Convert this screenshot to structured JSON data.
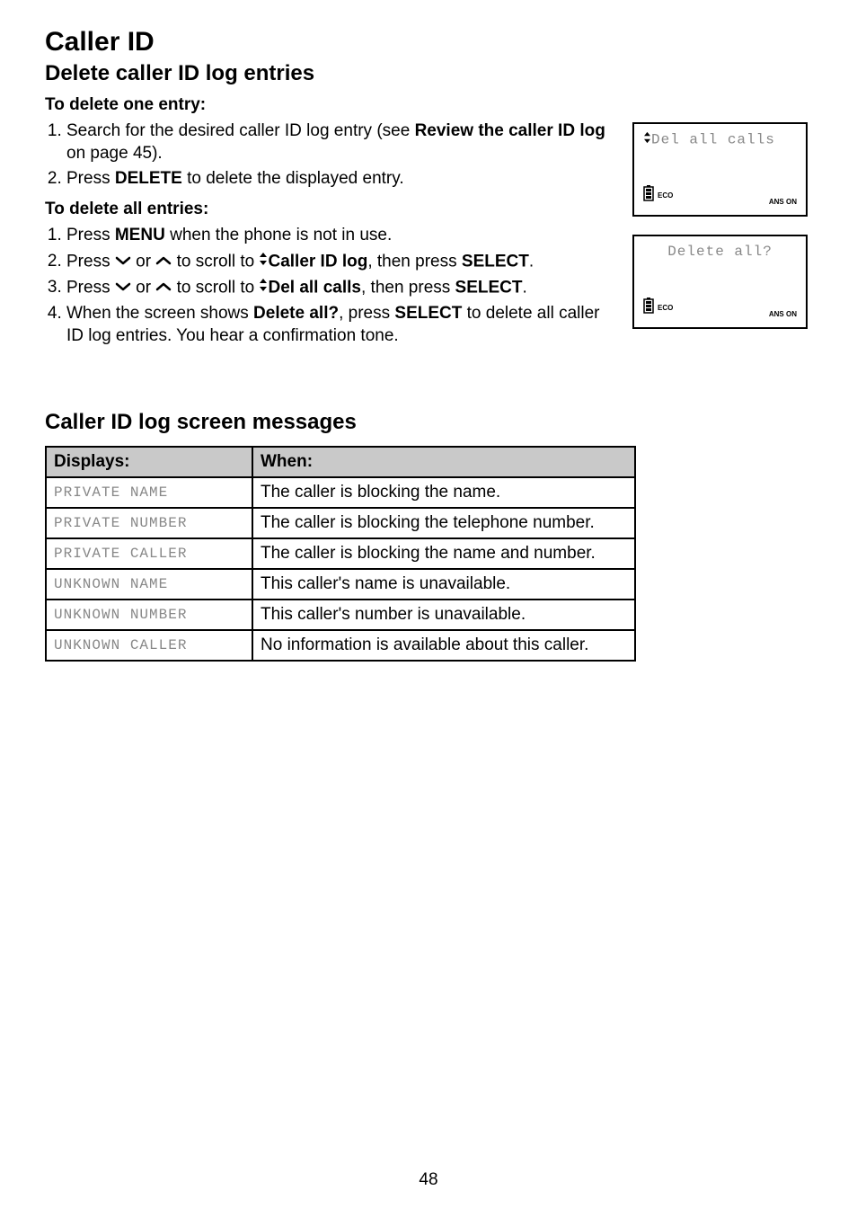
{
  "title": "Caller ID",
  "section1": {
    "heading": "Delete caller ID log entries",
    "subheading1": "To delete one entry:",
    "step1_prefix": "Search for the desired caller ID log entry (see ",
    "step1_bold": "Review the caller ID log",
    "step1_suffix": " on page 45).",
    "step2_prefix": "Press ",
    "step2_bold": "DELETE",
    "step2_suffix": " to delete the displayed entry.",
    "subheading2": "To delete all entries:",
    "allstep1_prefix": "Press ",
    "allstep1_bold": "MENU",
    "allstep1_suffix": " when the phone is not in use.",
    "allstep2_prefix": "Press ",
    "allstep2_mid": " or ",
    "allstep2_scroll": " to scroll to ",
    "allstep2_bold": "Caller ID log",
    "allstep2_then": ", then press ",
    "allstep2_select": "SELECT",
    "allstep2_period": ".",
    "allstep3_prefix": "Press ",
    "allstep3_mid": " or ",
    "allstep3_scroll": " to scroll to ",
    "allstep3_bold": "Del all calls",
    "allstep3_then": ", then press ",
    "allstep3_select": "SELECT",
    "allstep3_period": ".",
    "allstep4_prefix": "When the screen shows ",
    "allstep4_bold1": "Delete all?",
    "allstep4_mid": ", press ",
    "allstep4_bold2": "SELECT",
    "allstep4_suffix": " to delete all caller ID log entries. You hear a confirmation tone."
  },
  "screens": {
    "screen1_text": "Del all calls",
    "screen2_text": "Delete all?",
    "eco": "ECO",
    "ans_on": "ANS ON"
  },
  "section2": {
    "heading": "Caller ID log screen messages",
    "col1_header": "Displays:",
    "col2_header": "When:",
    "rows": [
      {
        "display": "PRIVATE NAME",
        "when": "The caller is blocking the name."
      },
      {
        "display": "PRIVATE NUMBER",
        "when": "The caller is blocking the telephone number."
      },
      {
        "display": "PRIVATE CALLER",
        "when": "The caller is blocking the name and number."
      },
      {
        "display": "UNKNOWN NAME",
        "when": "This caller's name is unavailable."
      },
      {
        "display": "UNKNOWN NUMBER",
        "when": "This caller's number is unavailable."
      },
      {
        "display": "UNKNOWN CALLER",
        "when": "No information is available about this caller."
      }
    ]
  },
  "page_number": "48"
}
